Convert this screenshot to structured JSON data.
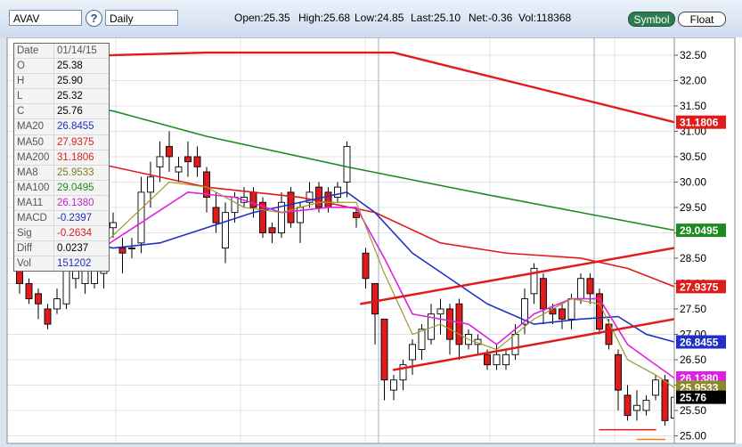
{
  "toolbar": {
    "symbol": "AVAV",
    "help_label": "?",
    "period": "Daily",
    "open": "Open:25.35",
    "high": "High:25.68",
    "low": "Low:24.85",
    "last": "Last:25.10",
    "net": "Net:-0.36",
    "vol": "Vol:118368",
    "symbol_button": "Symbol",
    "float_button": "Float"
  },
  "info_box": [
    {
      "label": "Date",
      "value": "01/14/15",
      "color": "#555555"
    },
    {
      "label": "O",
      "value": "25.38",
      "color": "#000000"
    },
    {
      "label": "H",
      "value": "25.90",
      "color": "#000000"
    },
    {
      "label": "L",
      "value": "25.32",
      "color": "#000000"
    },
    {
      "label": "C",
      "value": "25.76",
      "color": "#000000"
    },
    {
      "label": "MA20",
      "value": "26.8455",
      "color": "#1f2fc8"
    },
    {
      "label": "MA50",
      "value": "27.9375",
      "color": "#d81e1e"
    },
    {
      "label": "MA200",
      "value": "31.1806",
      "color": "#d81e1e"
    },
    {
      "label": "MA8",
      "value": "25.9533",
      "color": "#7d7d1a"
    },
    {
      "label": "MA100",
      "value": "29.0495",
      "color": "#1f8a1f"
    },
    {
      "label": "MA11",
      "value": "26.1380",
      "color": "#cc22cc"
    },
    {
      "label": "MACD",
      "value": "-0.2397",
      "color": "#1f2fc8"
    },
    {
      "label": "Sig",
      "value": "-0.2634",
      "color": "#d81e1e"
    },
    {
      "label": "Diff",
      "value": "0.0237",
      "color": "#000000"
    },
    {
      "label": "Vol",
      "value": "151202",
      "color": "#1f2fc8"
    }
  ],
  "chart_data": {
    "type": "candlestick",
    "ylim": [
      24.85,
      32.85
    ],
    "yticks": [
      25.0,
      25.5,
      26.0,
      26.5,
      27.0,
      27.5,
      28.0,
      28.5,
      29.0,
      29.5,
      30.0,
      30.5,
      31.0,
      31.5,
      32.0,
      32.5
    ],
    "candles": [
      [
        28.4,
        28.0,
        28.5,
        27.8
      ],
      [
        28.0,
        27.7,
        28.1,
        27.6
      ],
      [
        27.8,
        27.6,
        27.9,
        27.3
      ],
      [
        27.5,
        27.2,
        27.6,
        27.1
      ],
      [
        27.5,
        27.7,
        27.9,
        27.4
      ],
      [
        27.6,
        28.3,
        28.5,
        27.5
      ],
      [
        28.1,
        28.4,
        28.5,
        27.9
      ],
      [
        28.0,
        28.5,
        28.6,
        27.8
      ],
      [
        28.0,
        28.6,
        28.7,
        27.9
      ],
      [
        28.2,
        29.1,
        29.2,
        27.9
      ],
      [
        29.1,
        29.2,
        29.4,
        28.9
      ],
      [
        28.7,
        28.6,
        28.9,
        28.2
      ],
      [
        28.7,
        28.7,
        28.9,
        28.5
      ],
      [
        28.8,
        29.8,
        30.1,
        28.6
      ],
      [
        29.8,
        30.1,
        30.4,
        29.5
      ],
      [
        30.3,
        30.5,
        30.8,
        30.0
      ],
      [
        30.7,
        30.5,
        31.0,
        30.2
      ],
      [
        30.2,
        30.3,
        30.5,
        30.0
      ],
      [
        30.5,
        30.4,
        30.8,
        30.1
      ],
      [
        30.5,
        30.3,
        30.7,
        30.1
      ],
      [
        30.2,
        29.7,
        30.3,
        29.4
      ],
      [
        29.5,
        29.2,
        29.8,
        29.0
      ],
      [
        28.7,
        29.4,
        29.6,
        28.4
      ],
      [
        29.4,
        29.7,
        29.8,
        29.2
      ],
      [
        29.6,
        29.7,
        29.9,
        29.5
      ],
      [
        29.8,
        29.5,
        29.9,
        29.3
      ],
      [
        29.6,
        29.0,
        29.7,
        28.9
      ],
      [
        29.1,
        29.0,
        29.2,
        28.8
      ],
      [
        29.0,
        29.6,
        29.8,
        28.9
      ],
      [
        29.8,
        29.2,
        29.9,
        29.1
      ],
      [
        29.2,
        29.5,
        29.6,
        28.8
      ],
      [
        29.6,
        29.8,
        30.0,
        29.5
      ],
      [
        29.9,
        29.5,
        30.0,
        29.4
      ],
      [
        29.8,
        29.5,
        29.9,
        29.4
      ],
      [
        29.7,
        29.9,
        30.0,
        29.6
      ],
      [
        30.0,
        30.7,
        30.8,
        29.7
      ],
      [
        29.4,
        29.3,
        29.5,
        29.1
      ],
      [
        28.6,
        28.1,
        28.7,
        27.9
      ],
      [
        28.0,
        27.4,
        28.0,
        26.8
      ],
      [
        27.3,
        26.1,
        27.3,
        25.7
      ],
      [
        25.9,
        26.1,
        26.2,
        25.7
      ],
      [
        26.1,
        26.4,
        26.5,
        25.9
      ],
      [
        26.5,
        26.8,
        26.9,
        26.2
      ],
      [
        26.7,
        27.1,
        27.2,
        26.5
      ],
      [
        26.9,
        27.4,
        27.6,
        26.8
      ],
      [
        27.4,
        27.5,
        27.7,
        27.0
      ],
      [
        27.5,
        26.9,
        27.6,
        26.6
      ],
      [
        27.6,
        26.8,
        27.7,
        26.5
      ],
      [
        26.8,
        27.0,
        27.1,
        26.7
      ],
      [
        26.8,
        26.9,
        27.0,
        26.6
      ],
      [
        26.6,
        26.4,
        26.7,
        26.3
      ],
      [
        26.4,
        26.6,
        26.8,
        26.3
      ],
      [
        26.4,
        26.6,
        26.7,
        26.3
      ],
      [
        26.6,
        27.0,
        27.2,
        26.5
      ],
      [
        27.2,
        27.7,
        27.9,
        27.0
      ],
      [
        27.8,
        28.3,
        28.4,
        27.6
      ],
      [
        28.1,
        27.5,
        28.2,
        27.2
      ],
      [
        27.5,
        27.4,
        27.6,
        27.2
      ],
      [
        27.5,
        27.3,
        27.6,
        27.1
      ],
      [
        27.3,
        27.7,
        27.8,
        27.1
      ],
      [
        27.7,
        28.1,
        28.2,
        27.6
      ],
      [
        28.1,
        27.8,
        28.2,
        27.6
      ],
      [
        27.8,
        27.1,
        27.9,
        27.0
      ],
      [
        27.2,
        26.8,
        27.3,
        26.7
      ],
      [
        26.6,
        25.9,
        26.7,
        25.5
      ],
      [
        25.8,
        25.4,
        26.0,
        25.3
      ],
      [
        25.5,
        25.6,
        25.9,
        25.3
      ],
      [
        25.5,
        25.7,
        25.8,
        25.4
      ],
      [
        25.8,
        26.1,
        26.2,
        25.7
      ],
      [
        26.1,
        25.3,
        26.2,
        25.2
      ],
      [
        25.35,
        25.76,
        25.9,
        25.32
      ]
    ],
    "moving_averages": [
      {
        "name": "MA200",
        "color": "#e01b1b",
        "width": 2.4,
        "x": [
          0,
          20,
          40,
          70
        ],
        "y": [
          32.45,
          32.55,
          32.55,
          31.18
        ]
      },
      {
        "name": "MA100",
        "color": "#1f8a1f",
        "width": 1.6,
        "x": [
          0,
          10,
          20,
          35,
          50,
          60,
          70
        ],
        "y": [
          31.7,
          31.4,
          30.9,
          30.3,
          29.75,
          29.4,
          29.05
        ]
      },
      {
        "name": "MA50",
        "color": "#e01b1b",
        "width": 1.6,
        "x": [
          0,
          10,
          20,
          30,
          38,
          45,
          52,
          60,
          65,
          70
        ],
        "y": [
          30.7,
          30.3,
          29.9,
          29.7,
          29.4,
          28.8,
          28.6,
          28.5,
          28.3,
          27.94
        ]
      },
      {
        "name": "MA20",
        "color": "#1f2fc8",
        "width": 1.6,
        "x": [
          0,
          5,
          10,
          15,
          20,
          25,
          30,
          35,
          38,
          42,
          46,
          50,
          55,
          60,
          64,
          67,
          70
        ],
        "y": [
          29.1,
          28.9,
          28.7,
          28.8,
          29.1,
          29.4,
          29.6,
          29.8,
          29.4,
          28.6,
          28.1,
          27.6,
          27.2,
          27.3,
          27.35,
          27.0,
          26.85
        ]
      },
      {
        "name": "MA11",
        "color": "#e020e0",
        "width": 1.6,
        "x": [
          8,
          13,
          18,
          23,
          28,
          33,
          36,
          39,
          42,
          45,
          48,
          51,
          55,
          59,
          62,
          65,
          68,
          70
        ],
        "y": [
          28.6,
          29.2,
          29.8,
          29.7,
          29.4,
          29.5,
          29.5,
          28.5,
          27.4,
          27.3,
          27.2,
          26.8,
          27.4,
          27.7,
          27.7,
          26.8,
          26.4,
          26.14
        ]
      },
      {
        "name": "MA8",
        "color": "#9a9a30",
        "width": 1.2,
        "x": [
          8,
          12,
          16,
          20,
          24,
          28,
          32,
          36,
          39,
          42,
          45,
          48,
          51,
          55,
          59,
          62,
          65,
          68,
          70
        ],
        "y": [
          28.6,
          29.3,
          30.0,
          29.9,
          29.5,
          29.4,
          29.6,
          29.6,
          28.2,
          27.0,
          27.2,
          26.9,
          26.7,
          27.3,
          27.7,
          27.6,
          26.5,
          26.2,
          25.95
        ]
      }
    ],
    "trendlines": [
      {
        "x": [
          36.5,
          73
        ],
        "y": [
          27.6,
          28.8
        ],
        "color": "#e01b1b",
        "width": 2.5
      },
      {
        "x": [
          40,
          73
        ],
        "y": [
          26.3,
          27.4
        ],
        "color": "#e01b1b",
        "width": 2.5
      },
      {
        "x": [
          62,
          68
        ],
        "y": [
          25.12,
          25.12
        ],
        "color": "#e01b1b",
        "width": 1.5
      },
      {
        "x": [
          66,
          69
        ],
        "y": [
          24.93,
          24.93
        ],
        "color": "#ff7a00",
        "width": 1.5
      }
    ],
    "price_tags": [
      {
        "label": "31.1806",
        "value": 31.18,
        "bg": "#e01b1b",
        "fg": "#ffffff"
      },
      {
        "label": "29.0495",
        "value": 29.05,
        "bg": "#1f8a1f",
        "fg": "#ffffff"
      },
      {
        "label": "27.9375",
        "value": 27.94,
        "bg": "#e01b1b",
        "fg": "#ffffff"
      },
      {
        "label": "26.8455",
        "value": 26.85,
        "bg": "#1f2fc8",
        "fg": "#ffffff"
      },
      {
        "label": "26.1380",
        "value": 26.14,
        "bg": "#e020e0",
        "fg": "#ffffff"
      },
      {
        "label": "25.9533",
        "value": 25.953,
        "bg": "#8a8a2a",
        "fg": "#ffffff"
      },
      {
        "label": "25.76",
        "value": 25.76,
        "bg": "#000000",
        "fg": "#ffffff"
      }
    ],
    "colors": {
      "up": "#ffffff",
      "down": "#e01b1b",
      "grid": "#e4e4e4",
      "background": "#ffffff",
      "divider": "#9cb0c8"
    }
  }
}
